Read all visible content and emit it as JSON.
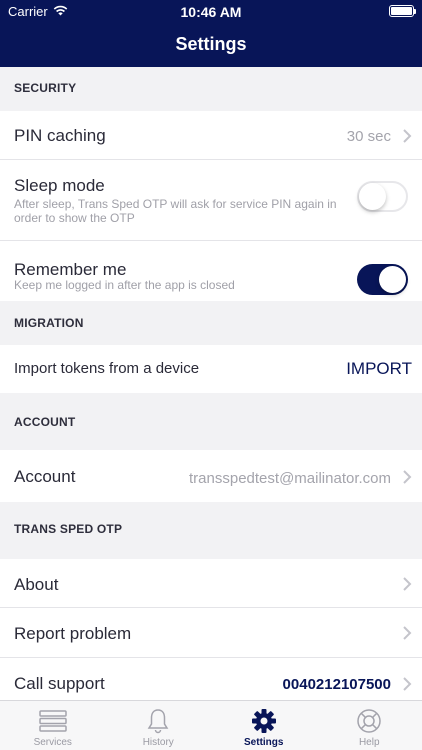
{
  "status_bar": {
    "carrier": "Carrier",
    "time": "10:46 AM"
  },
  "nav": {
    "title": "Settings"
  },
  "sections": {
    "security": "SECURITY",
    "migration": "MIGRATION",
    "account": "ACCOUNT",
    "app": "TRANS SPED OTP"
  },
  "security": {
    "pin_caching": {
      "label": "PIN caching",
      "value": "30 sec"
    },
    "sleep_mode": {
      "label": "Sleep mode",
      "description": "After sleep, Trans Sped OTP will ask for service PIN again in order to show the OTP",
      "enabled": false
    },
    "remember_me": {
      "label": "Remember me",
      "description": "Keep me logged in after the app is closed",
      "enabled": true
    }
  },
  "migration": {
    "label": "Import tokens from a device",
    "button": "IMPORT"
  },
  "account": {
    "label": "Account",
    "value": "transspedtest@mailinator.com"
  },
  "app": {
    "about": "About",
    "report": "Report problem",
    "support": {
      "label": "Call support",
      "value": "0040212107500"
    }
  },
  "tabs": [
    {
      "label": "Services",
      "icon": "list-icon",
      "active": false
    },
    {
      "label": "History",
      "icon": "bell-icon",
      "active": false
    },
    {
      "label": "Settings",
      "icon": "gear-icon",
      "active": true
    },
    {
      "label": "Help",
      "icon": "lifebuoy-icon",
      "active": false
    }
  ],
  "colors": {
    "primary": "#081558",
    "background": "#f2f2f4",
    "muted": "#a0a0a8"
  }
}
